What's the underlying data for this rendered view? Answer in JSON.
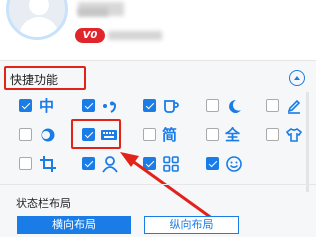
{
  "profile": {
    "vip_label": "V0"
  },
  "quick_functions": {
    "title": "快捷功能",
    "rows": [
      [
        {
          "icon": "chinese-input-icon",
          "glyph": "中",
          "checked": true
        },
        {
          "icon": "punctuation-icon",
          "glyph": "•,",
          "checked": true
        },
        {
          "icon": "cup-icon",
          "checked": true
        },
        {
          "icon": "moon-icon",
          "checked": false
        },
        {
          "icon": "pen-icon",
          "checked": false
        }
      ],
      [
        {
          "icon": "fullwidth-icon",
          "checked": false
        },
        {
          "icon": "keyboard-icon",
          "checked": true
        },
        {
          "icon": "simplified-icon",
          "glyph": "简",
          "checked": false
        },
        {
          "icon": "full-icon",
          "glyph": "全",
          "checked": false
        },
        {
          "icon": "shirt-icon",
          "checked": false
        }
      ],
      [
        {
          "icon": "crop-icon",
          "checked": false
        },
        {
          "icon": "user-icon",
          "checked": true
        },
        {
          "icon": "grid-icon",
          "checked": true
        },
        {
          "icon": "smile-icon",
          "checked": true
        }
      ]
    ]
  },
  "statusbar": {
    "title": "状态栏布局",
    "horizontal_label": "横向布局",
    "vertical_label": "纵向布局"
  },
  "colors": {
    "accent": "#1a7ce6",
    "highlight": "#e2231a",
    "vip": "#e0262b"
  }
}
